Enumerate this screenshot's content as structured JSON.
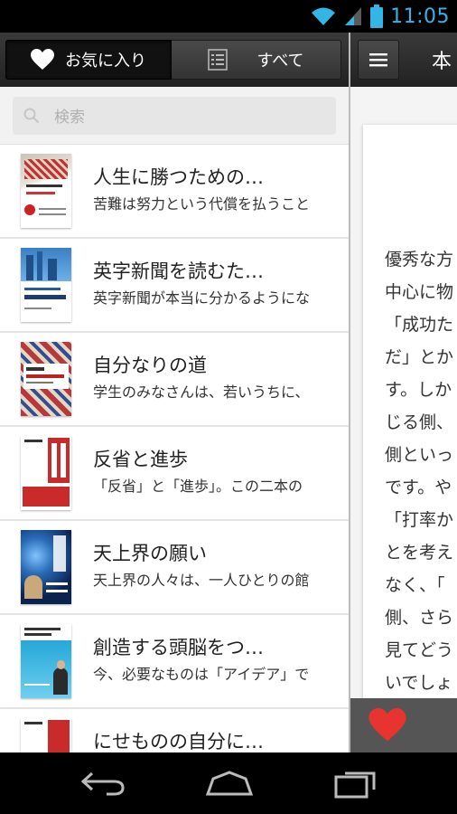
{
  "status": {
    "time": "11:05"
  },
  "tabs": {
    "favorites_label": "お気に入り",
    "all_label": "すべて"
  },
  "search": {
    "placeholder": "検索"
  },
  "books": [
    {
      "title": "人生に勝つための…",
      "subtitle": "苦難は努力という代償を払うこと"
    },
    {
      "title": "英字新聞を読むた…",
      "subtitle": "英字新聞が本当に分かるようにな"
    },
    {
      "title": "自分なりの道",
      "subtitle": "学生のみなさんは、若いうちに、"
    },
    {
      "title": "反省と進歩",
      "subtitle": "「反省」と「進歩」。この二本の"
    },
    {
      "title": "天上界の願い",
      "subtitle": "天上界の人々は、一人ひとりの館"
    },
    {
      "title": "創造する頭脳をつ…",
      "subtitle": "今、必要なものは「アイデア」で"
    },
    {
      "title": "にせものの自分に…",
      "subtitle": ""
    }
  ],
  "reader": {
    "title": "本",
    "lines": [
      "優秀な方",
      "中心に物",
      "「成功た",
      "だ」とか",
      "す。しか",
      "じる側、",
      "側といっ",
      "です。や",
      "「打率か",
      "とを考え",
      "なく、「",
      "側、さら",
      "見てどう",
      "いでしょ"
    ]
  },
  "colors": {
    "accent": "#33b5e5",
    "heart": "#e8342f"
  }
}
